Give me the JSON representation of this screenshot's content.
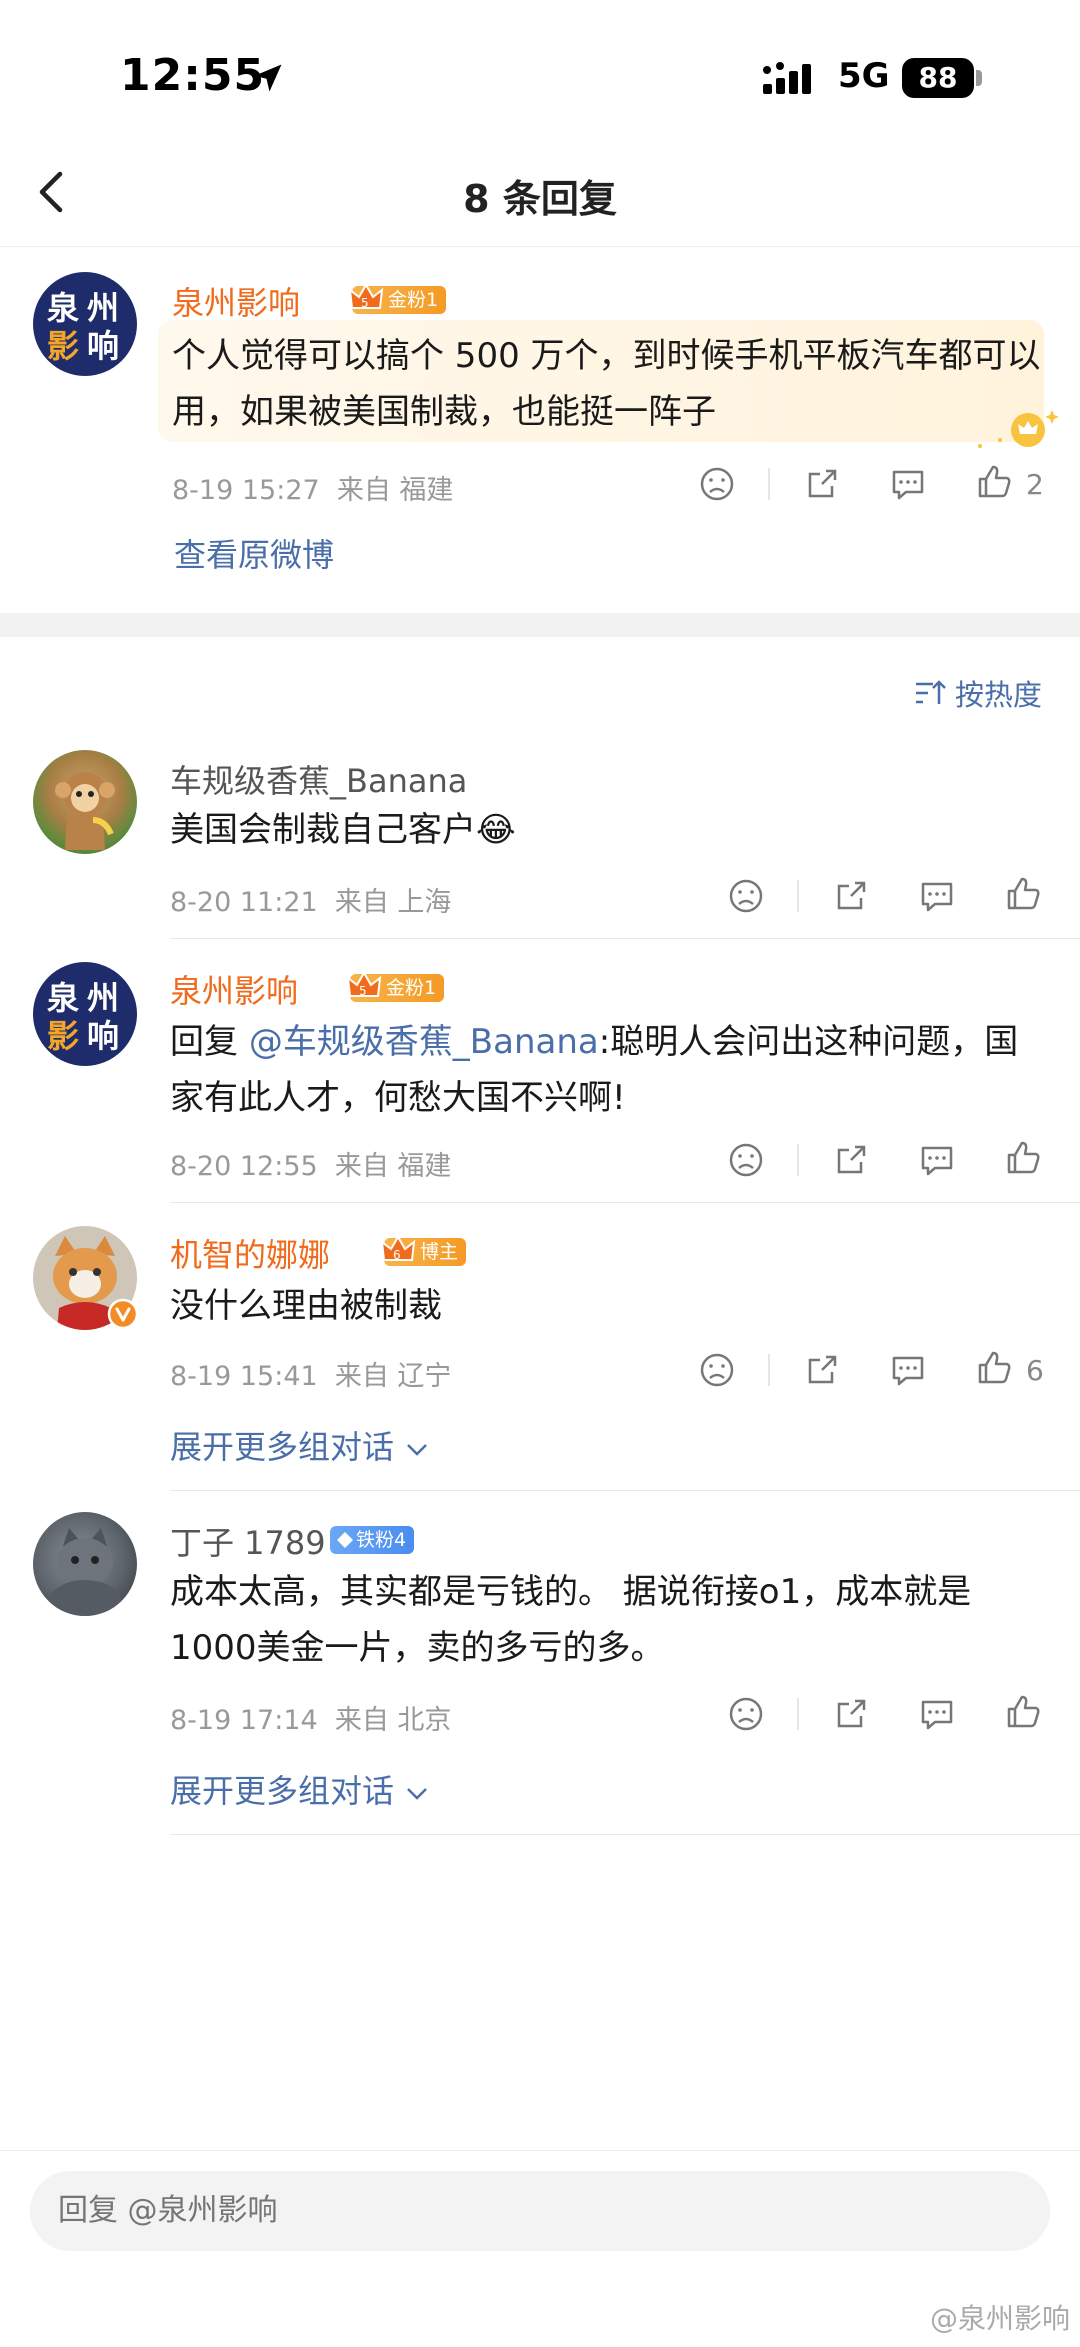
{
  "status_bar": {
    "time": "12:55",
    "network": "5G",
    "battery": "88"
  },
  "nav": {
    "title": "8 条回复"
  },
  "original_comment": {
    "avatar_text": [
      "泉",
      "州",
      "影",
      "响"
    ],
    "username": "泉州影响",
    "badge": "金粉1",
    "badge_level": "5",
    "content": "个人觉得可以搞个 500 万个，到时候手机平板汽车都可以用，如果被美国制裁，也能挺一阵子",
    "time": "8-19 15:27",
    "location": "来自 福建",
    "likes": "2",
    "view_original": "查看原微博"
  },
  "sort": {
    "label": "按热度"
  },
  "replies": [
    {
      "username": "车规级香蕉_Banana",
      "content": "美国会制裁自己客户",
      "emoji": "😂",
      "time": "8-20 11:21",
      "location": "来自 上海"
    },
    {
      "avatar_text": [
        "泉",
        "州",
        "影",
        "响"
      ],
      "username": "泉州影响",
      "badge": "金粉1",
      "badge_level": "5",
      "reply_prefix": "回复",
      "mention": "@车规级香蕉_Banana",
      "content_rest": ":聪明人会问出这种问题，国家有此人才，何愁大国不兴啊!",
      "time": "8-20 12:55",
      "location": "来自 福建"
    },
    {
      "username": "机智的娜娜",
      "badge": "博主",
      "badge_level": "6",
      "content": "没什么理由被制裁",
      "time": "8-19 15:41",
      "location": "来自 辽宁",
      "likes": "6",
      "expand": "展开更多组对话"
    },
    {
      "username": "丁子 1789",
      "badge": "铁粉4",
      "content": "成本太高，其实都是亏钱的。 据说衔接o1，成本就是1000美金一片，卖的多亏的多。",
      "time": "8-19 17:14",
      "location": "来自 北京",
      "expand": "展开更多组对话"
    }
  ],
  "reply_bar": {
    "placeholder": "回复 @泉州影响"
  },
  "watermark": "@泉州影响",
  "colors": {
    "vip_name": "#f26a1b",
    "link": "#4a6ea9",
    "meta": "#999999",
    "brand_avatar": "#1e2c6b"
  }
}
